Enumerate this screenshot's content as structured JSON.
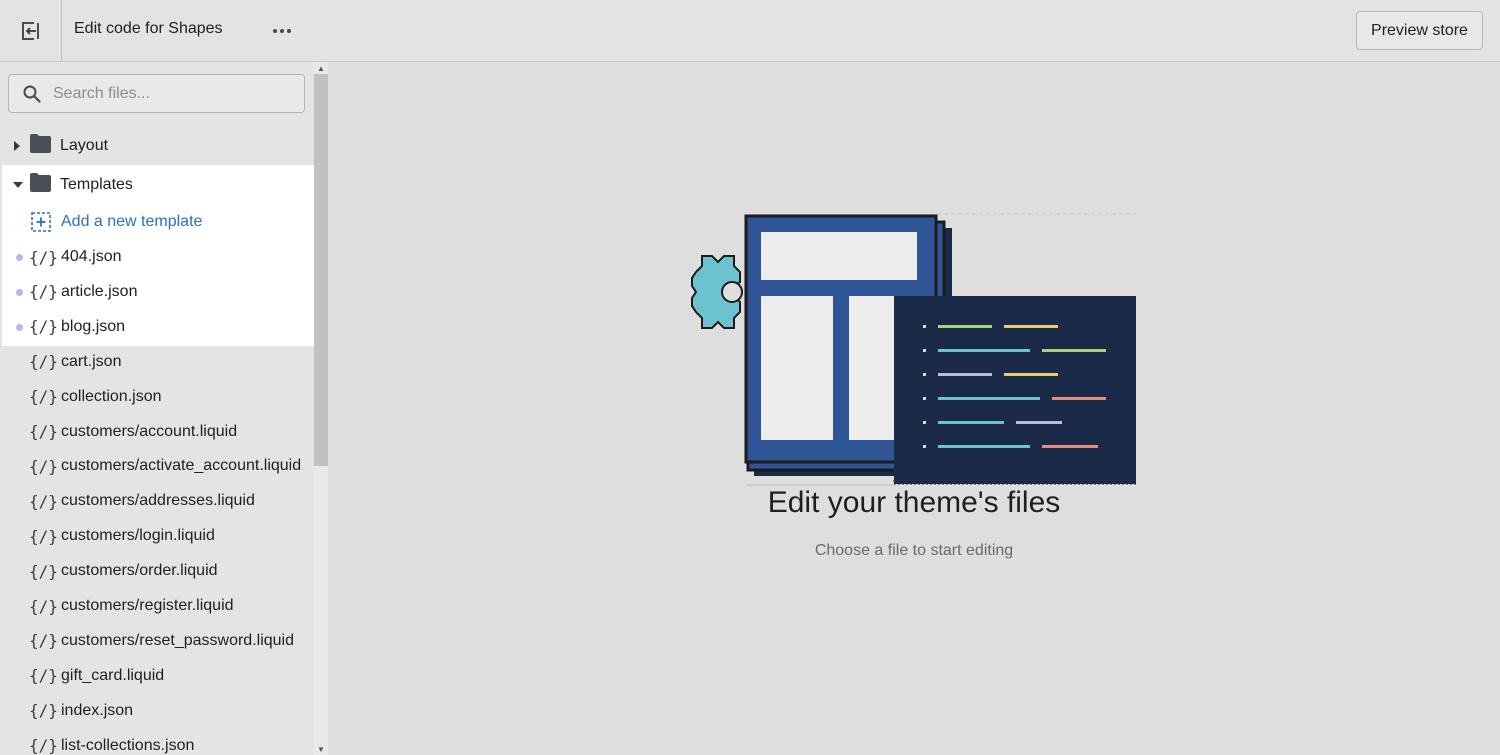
{
  "topbar": {
    "title": "Edit code for Shapes",
    "more_label": "•••",
    "preview_label": "Preview store"
  },
  "sidebar": {
    "search_placeholder": "Search files...",
    "folders": {
      "layout": "Layout",
      "templates": "Templates"
    },
    "add_template": "Add a new template",
    "code_icon_glyph": "{/}",
    "files": [
      {
        "name": "404.json",
        "modified": true
      },
      {
        "name": "article.json",
        "modified": true
      },
      {
        "name": "blog.json",
        "modified": true
      },
      {
        "name": "cart.json",
        "modified": false
      },
      {
        "name": "collection.json",
        "modified": false
      },
      {
        "name": "customers/account.liquid",
        "modified": false
      },
      {
        "name": "customers/activate_account.liquid",
        "modified": false
      },
      {
        "name": "customers/addresses.liquid",
        "modified": false
      },
      {
        "name": "customers/login.liquid",
        "modified": false
      },
      {
        "name": "customers/order.liquid",
        "modified": false
      },
      {
        "name": "customers/register.liquid",
        "modified": false
      },
      {
        "name": "customers/reset_password.liquid",
        "modified": false
      },
      {
        "name": "gift_card.liquid",
        "modified": false
      },
      {
        "name": "index.json",
        "modified": false
      },
      {
        "name": "list-collections.json",
        "modified": false
      }
    ]
  },
  "main": {
    "empty_title": "Edit your theme's files",
    "empty_subtitle": "Choose a file to start editing"
  },
  "colors": {
    "accent_link": "#2c6ecb",
    "modified_dot": "#b9b7ec",
    "illustration_blue": "#2f5597",
    "illustration_navy": "#1a2a48",
    "illustration_teal": "#6cc3cf"
  }
}
